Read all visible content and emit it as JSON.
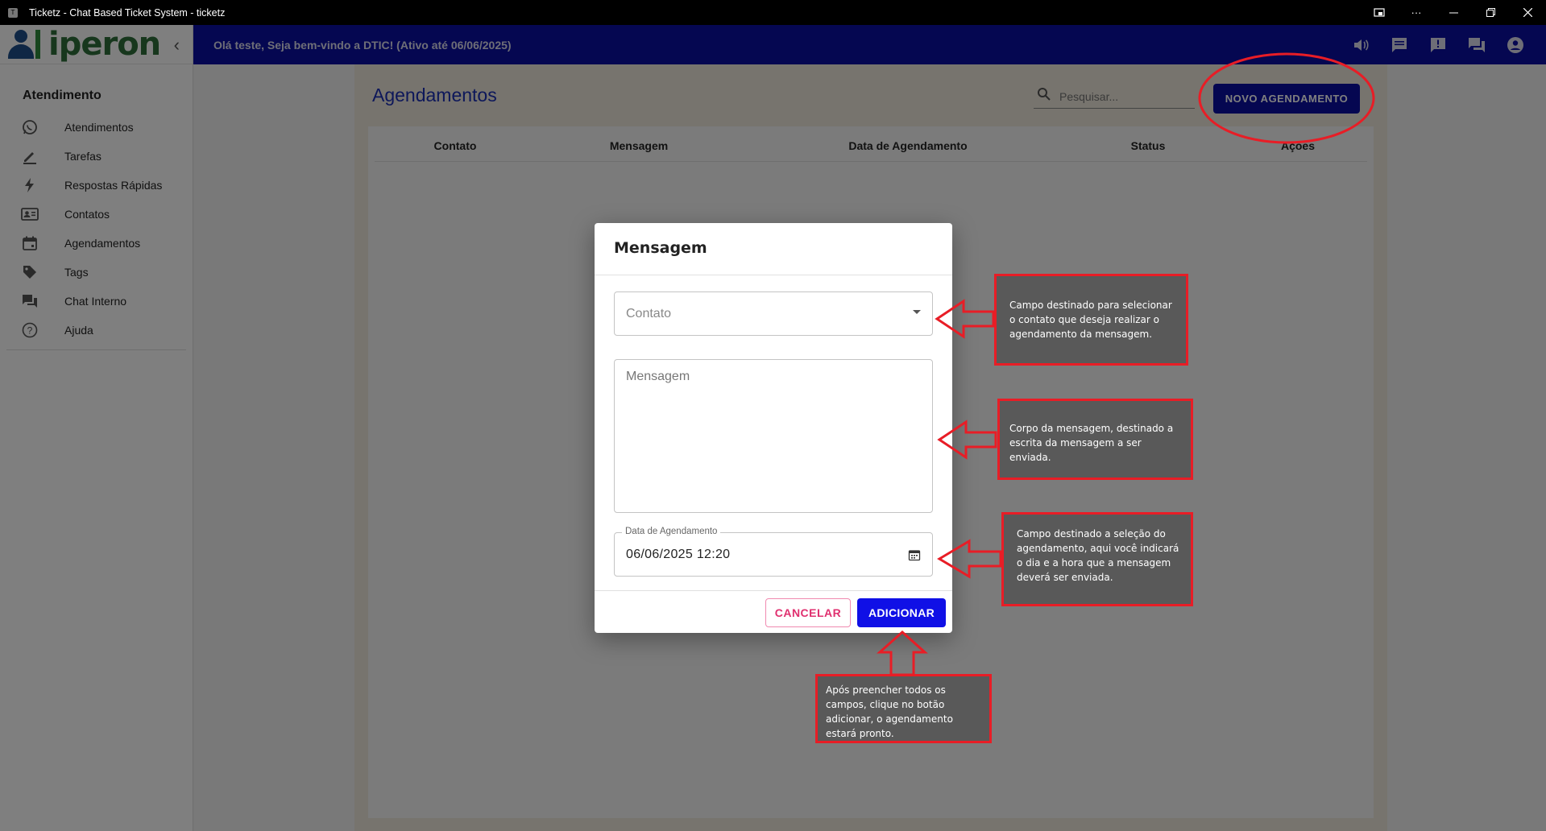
{
  "window": {
    "title": "Ticketz - Chat Based Ticket System - ticketz",
    "app_icon": "T",
    "controls": [
      "cast-icon",
      "more-icon",
      "minimize-icon",
      "restore-icon",
      "close-icon"
    ]
  },
  "sidebar": {
    "logo_text": "iperon",
    "section_title": "Atendimento",
    "items": [
      {
        "label": "Atendimentos",
        "icon": "whatsapp-icon"
      },
      {
        "label": "Tarefas",
        "icon": "pencil-icon"
      },
      {
        "label": "Respostas Rápidas",
        "icon": "lightning-icon"
      },
      {
        "label": "Contatos",
        "icon": "contact-card-icon"
      },
      {
        "label": "Agendamentos",
        "icon": "calendar-icon"
      },
      {
        "label": "Tags",
        "icon": "tag-icon"
      },
      {
        "label": "Chat Interno",
        "icon": "forum-icon"
      },
      {
        "label": "Ajuda",
        "icon": "help-icon"
      }
    ]
  },
  "topbar": {
    "welcome": "Olá teste, Seja bem-vindo a DTIC! (Ativo até 06/06/2025)",
    "icons": [
      "volume-icon",
      "chat-icon",
      "announcement-icon",
      "forum-icon",
      "account-icon"
    ]
  },
  "page": {
    "title": "Agendamentos",
    "search_placeholder": "Pesquisar...",
    "new_button": "NOVO AGENDAMENTO",
    "columns": [
      "Contato",
      "Mensagem",
      "Data de Agendamento",
      "Status",
      "Ações"
    ]
  },
  "dialog": {
    "title": "Mensagem",
    "contact_placeholder": "Contato",
    "message_placeholder": "Mensagem",
    "date_label": "Data de Agendamento",
    "date_value": "06/06/2025 12:20",
    "cancel_label": "CANCELAR",
    "add_label": "ADICIONAR"
  },
  "annotations": {
    "contact": "Campo destinado para selecionar o contato que deseja realizar o agendamento da mensagem.",
    "message": "Corpo da mensagem, destinado a escrita da mensagem a ser enviada.",
    "date": "Campo destinado a seleção do agendamento, aqui você indicará o dia e a hora que a mensagem deverá ser enviada.",
    "add": "Após preencher todos os campos, clique no botão adicionar, o agendamento estará pronto."
  },
  "colors": {
    "brand_blue": "#0b0fa3",
    "annotation_red": "#e81d26",
    "add_button": "#1010e6",
    "cancel_text": "#e0306f"
  }
}
